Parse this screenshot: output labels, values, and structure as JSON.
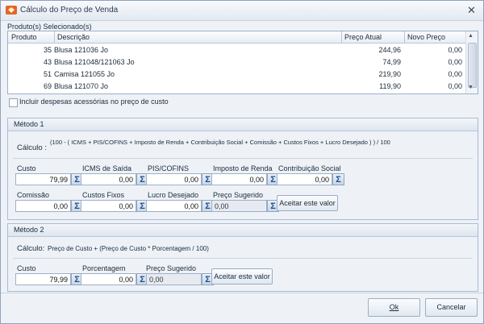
{
  "window": {
    "title": "Cálculo do Preço de Venda",
    "close_label": "✕"
  },
  "products": {
    "section_label": "Produto(s) Selecionado(s)",
    "columns": [
      "Produto",
      "Descrição",
      "Preço Atual",
      "Novo Preço"
    ],
    "rows": [
      {
        "produto": "35",
        "descricao": "Blusa 121036 Jo",
        "preco_atual": "244,96",
        "novo_preco": "0,00"
      },
      {
        "produto": "43",
        "descricao": "Blusa 121048/121063 Jo",
        "preco_atual": "74,99",
        "novo_preco": "0,00"
      },
      {
        "produto": "51",
        "descricao": "Camisa 121055 Jo",
        "preco_atual": "219,90",
        "novo_preco": "0,00"
      },
      {
        "produto": "69",
        "descricao": "Blusa 121070 Jo",
        "preco_atual": "119,90",
        "novo_preco": "0,00"
      }
    ],
    "scroll_up": "▲",
    "scroll_down": "▼"
  },
  "include_expenses": {
    "label": "Incluir despesas acessórias no preço de custo",
    "checked": false
  },
  "metodo1": {
    "title": "Método 1",
    "calc_label": "Cálculo :",
    "formula": "(100 - ( ICMS + PIS/COFINS + Imposto de Renda + Contribuição Social + Comissão + Custos Fixos + Lucro Desejado ) ) / 100",
    "fields": {
      "custo": {
        "label": "Custo",
        "value": "79,99"
      },
      "icms": {
        "label": "ICMS de Saída",
        "value": "0,00"
      },
      "pis_cofins": {
        "label": "PIS/COFINS",
        "value": "0,00"
      },
      "imposto_renda": {
        "label": "Imposto de Renda",
        "value": "0,00"
      },
      "contribuicao": {
        "label": "Contribuição Social",
        "value": "0,00"
      },
      "comissao": {
        "label": "Comissão",
        "value": "0,00"
      },
      "custos_fixos": {
        "label": "Custos Fixos",
        "value": "0,00"
      },
      "lucro": {
        "label": "Lucro Desejado",
        "value": "0,00"
      },
      "preco_sugerido": {
        "label": "Preço Sugerido",
        "value": "0,00"
      }
    },
    "accept_button": "Aceitar este valor"
  },
  "metodo2": {
    "title": "Método 2",
    "calc_label": "Cálculo:",
    "formula": "Preço de Custo + (Preço de Custo * Porcentagem / 100)",
    "fields": {
      "custo": {
        "label": "Custo",
        "value": "79,99"
      },
      "porcentagem": {
        "label": "Porcentagem",
        "value": "0,00"
      },
      "preco_sugerido": {
        "label": "Preço Sugerido",
        "value": "0,00"
      }
    },
    "accept_button": "Aceitar este valor"
  },
  "sigma_glyph": "Σ",
  "footer": {
    "ok_label": "Ok",
    "cancel_label": "Cancelar"
  }
}
